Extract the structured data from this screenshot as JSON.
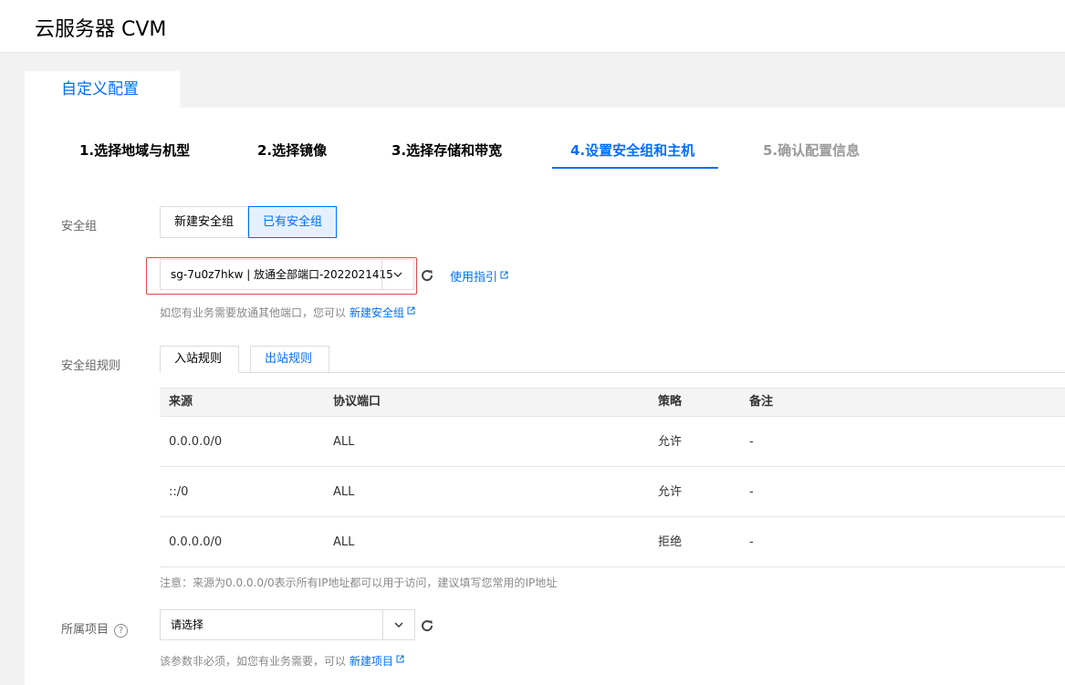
{
  "app": {
    "title": "云服务器 CVM"
  },
  "tabs": {
    "custom": "自定义配置"
  },
  "steps": [
    {
      "label": "1.选择地域与机型",
      "state": "done"
    },
    {
      "label": "2.选择镜像",
      "state": "done"
    },
    {
      "label": "3.选择存储和带宽",
      "state": "done"
    },
    {
      "label": "4.设置安全组和主机",
      "state": "active"
    },
    {
      "label": "5.确认配置信息",
      "state": "disabled"
    }
  ],
  "security_group": {
    "label": "安全组",
    "new_option": "新建安全组",
    "existing_option": "已有安全组",
    "selected_option": "existing",
    "select_value": "sg-7u0z7hkw | 放通全部端口-2022021415",
    "guide_link": "使用指引",
    "hint_text": "如您有业务需要放通其他端口，您可以",
    "hint_link": "新建安全组"
  },
  "rules": {
    "label": "安全组规则",
    "tab_inbound": "入站规则",
    "tab_outbound": "出站规则",
    "columns": [
      "来源",
      "协议端口",
      "策略",
      "备注"
    ],
    "rows": [
      [
        "0.0.0.0/0",
        "ALL",
        "允许",
        "-"
      ],
      [
        "::/0",
        "ALL",
        "允许",
        "-"
      ],
      [
        "0.0.0.0/0",
        "ALL",
        "拒绝",
        "-"
      ]
    ],
    "note": "注意：来源为0.0.0.0/0表示所有IP地址都可以用于访问，建议填写您常用的IP地址"
  },
  "project": {
    "label": "所属项目",
    "help_icon": "?",
    "select_value": "请选择",
    "hint_text": "该参数非必须，如您有业务需要，可以",
    "hint_link": "新建项目"
  },
  "colors": {
    "accent": "#006eff",
    "highlight_border": "#e54545"
  }
}
